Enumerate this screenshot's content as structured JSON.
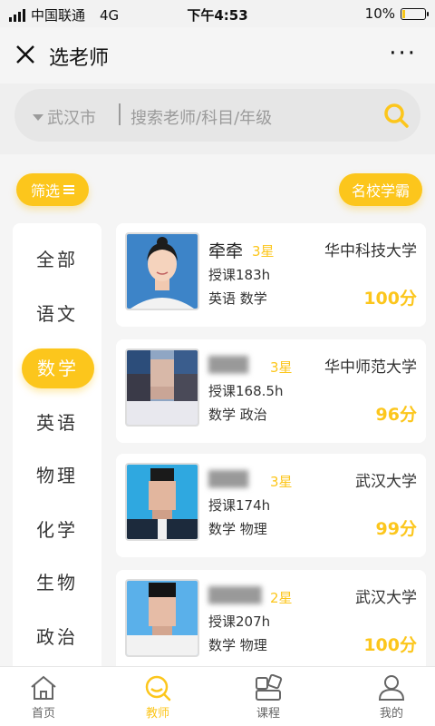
{
  "statusbar": {
    "carrier": "中国联通",
    "network": "4G",
    "time": "下午4:53",
    "battery": "10%"
  },
  "nav": {
    "title": "选老师",
    "more": "···"
  },
  "search": {
    "city": "武汉市",
    "placeholder": "搜索老师/科目/年级"
  },
  "filter": {
    "label": "筛选"
  },
  "elite": {
    "label": "名校学霸"
  },
  "sidebar": {
    "items": [
      {
        "label": "全部"
      },
      {
        "label": "语文"
      },
      {
        "label": "数学"
      },
      {
        "label": "英语"
      },
      {
        "label": "物理"
      },
      {
        "label": "化学"
      },
      {
        "label": "生物"
      },
      {
        "label": "政治"
      }
    ]
  },
  "teachers": [
    {
      "name": "牵牵",
      "stars": "3星",
      "school": "华中科技大学",
      "hours": "授课183h",
      "subjects": "英语 数学",
      "score": "100分"
    },
    {
      "name": "",
      "stars": "3星",
      "school": "华中师范大学",
      "hours": "授课168.5h",
      "subjects": "数学 政治",
      "score": "96分"
    },
    {
      "name": "",
      "stars": "3星",
      "school": "武汉大学",
      "hours": "授课174h",
      "subjects": "数学 物理",
      "score": "99分"
    },
    {
      "name": "",
      "stars": "2星",
      "school": "武汉大学",
      "hours": "授课207h",
      "subjects": "数学 物理",
      "score": "100分"
    }
  ],
  "tabbar": {
    "items": [
      {
        "label": "首页"
      },
      {
        "label": "教师"
      },
      {
        "label": "课程"
      },
      {
        "label": "我的"
      }
    ]
  },
  "colors": {
    "accent": "#fcc61c",
    "background": "#f5f5f5"
  }
}
